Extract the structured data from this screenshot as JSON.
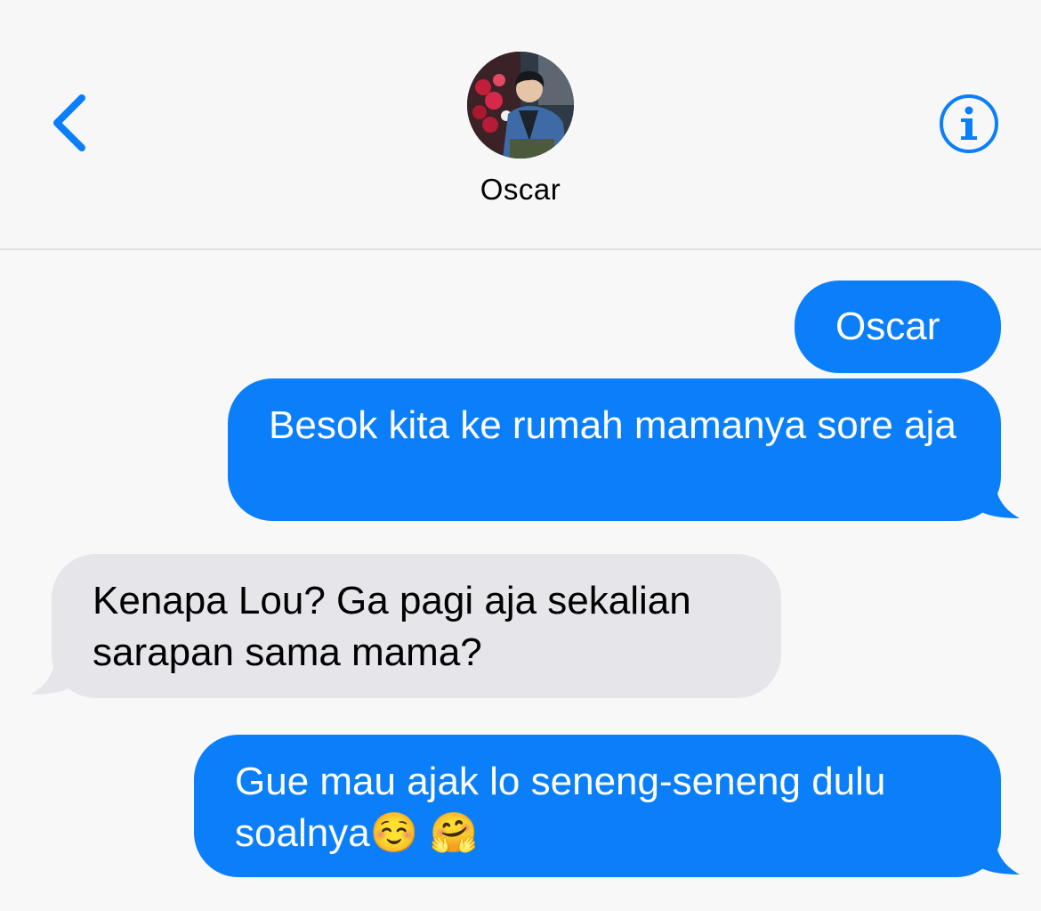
{
  "header": {
    "back_icon": "chevron-left-icon",
    "contact_name": "Oscar",
    "info_icon": "info-icon"
  },
  "colors": {
    "accent": "#0a7ff9",
    "received_bubble": "#e6e5ea",
    "background": "#f8f8f8"
  },
  "messages": [
    {
      "direction": "sent",
      "text": "Oscar"
    },
    {
      "direction": "sent",
      "text": "Besok kita ke rumah mamanya sore aja"
    },
    {
      "direction": "received",
      "text": "Kenapa Lou? Ga pagi aja sekalian sarapan sama mama?"
    },
    {
      "direction": "sent",
      "text": "Gue mau ajak lo seneng-seneng dulu soalnya",
      "emojis": [
        "☺️",
        "🤗"
      ]
    }
  ]
}
